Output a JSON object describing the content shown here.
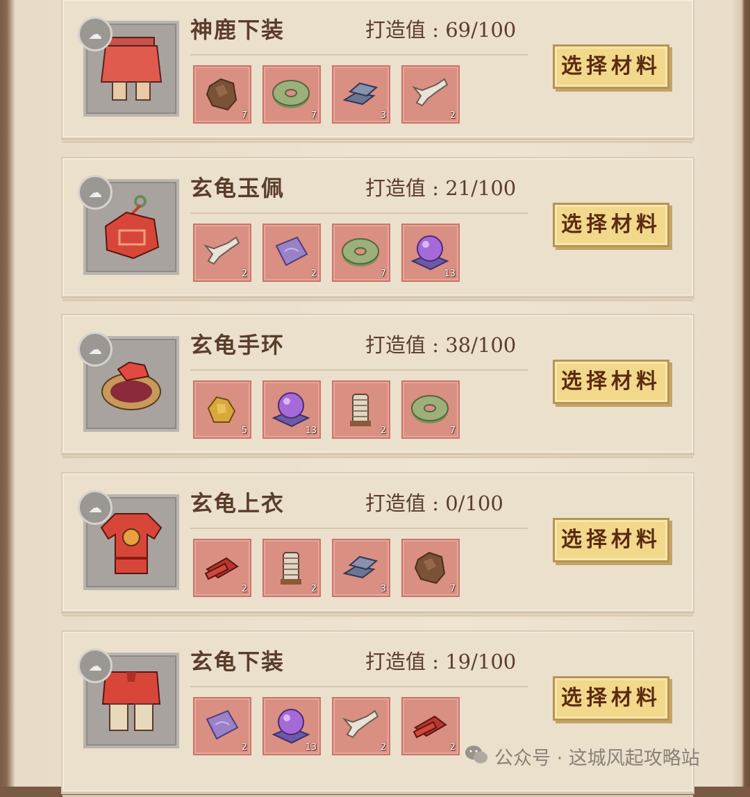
{
  "forge_label": "打造值",
  "button_label": "选择材料",
  "watermark": "公众号 · 这城风起攻略站",
  "items": [
    {
      "name": "神鹿下装",
      "progress": "69/100",
      "icon": "skirt-icon",
      "materials": [
        {
          "icon": "ore-rock-icon",
          "qty": "7"
        },
        {
          "icon": "jade-disc-icon",
          "qty": "7"
        },
        {
          "icon": "iron-ingot-icon",
          "qty": "3"
        },
        {
          "icon": "bone-icon",
          "qty": "2"
        }
      ]
    },
    {
      "name": "玄龟玉佩",
      "progress": "21/100",
      "icon": "jade-pendant-icon",
      "materials": [
        {
          "icon": "bone-icon",
          "qty": "2"
        },
        {
          "icon": "silk-cloth-icon",
          "qty": "2"
        },
        {
          "icon": "jade-disc-icon",
          "qty": "7"
        },
        {
          "icon": "purple-orb-icon",
          "qty": "13"
        }
      ]
    },
    {
      "name": "玄龟手环",
      "progress": "38/100",
      "icon": "bracelet-icon",
      "materials": [
        {
          "icon": "gold-ore-icon",
          "qty": "5"
        },
        {
          "icon": "purple-orb-icon",
          "qty": "13"
        },
        {
          "icon": "thread-spool-icon",
          "qty": "2"
        },
        {
          "icon": "jade-disc-icon",
          "qty": "7"
        }
      ]
    },
    {
      "name": "玄龟上衣",
      "progress": "0/100",
      "icon": "tunic-icon",
      "materials": [
        {
          "icon": "red-brocade-icon",
          "qty": "2"
        },
        {
          "icon": "thread-spool-icon",
          "qty": "2"
        },
        {
          "icon": "iron-ingot-icon",
          "qty": "3"
        },
        {
          "icon": "ore-rock-icon",
          "qty": "7"
        }
      ]
    },
    {
      "name": "玄龟下装",
      "progress": "19/100",
      "icon": "trousers-icon",
      "materials": [
        {
          "icon": "silk-cloth-icon",
          "qty": "2"
        },
        {
          "icon": "purple-orb-icon",
          "qty": "13"
        },
        {
          "icon": "bone-icon",
          "qty": "2"
        },
        {
          "icon": "red-brocade-icon",
          "qty": "2"
        }
      ]
    }
  ]
}
